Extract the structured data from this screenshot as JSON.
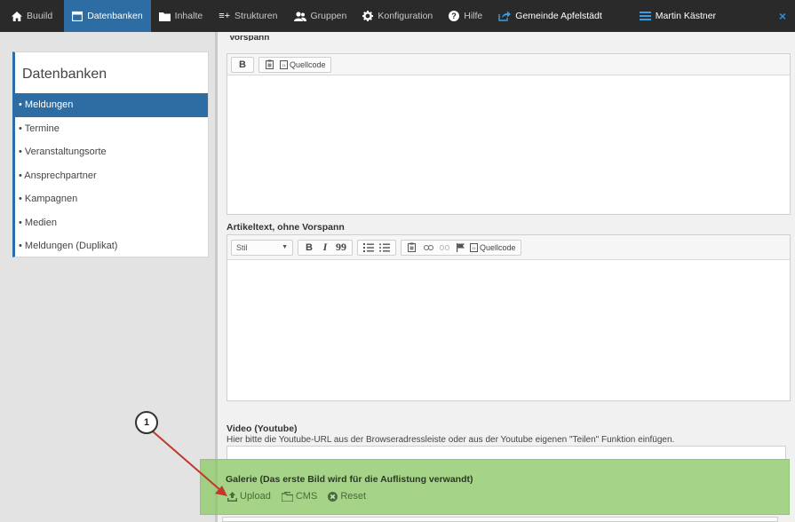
{
  "topbar": {
    "items": [
      {
        "label": "Buuild",
        "icon": "home-icon"
      },
      {
        "label": "Datenbanken",
        "icon": "calendar-icon"
      },
      {
        "label": "Inhalte",
        "icon": "folder-icon"
      },
      {
        "label": "Strukturen",
        "icon": "structure-icon"
      },
      {
        "label": "Gruppen",
        "icon": "users-icon"
      },
      {
        "label": "Konfiguration",
        "icon": "gear-icon"
      },
      {
        "label": "Hilfe",
        "icon": "help-icon"
      },
      {
        "label": "Gemeinde Apfelstädt",
        "icon": "share-icon"
      },
      {
        "label": "Martin Kästner",
        "icon": "menu-icon"
      }
    ],
    "close": "×",
    "accent": "#2e6da4"
  },
  "sidebar": {
    "title": "Datenbanken",
    "items": [
      {
        "label": "• Meldungen",
        "active": true
      },
      {
        "label": "• Termine"
      },
      {
        "label": "• Veranstaltungsorte"
      },
      {
        "label": "• Ansprechpartner"
      },
      {
        "label": "• Kampagnen"
      },
      {
        "label": "• Medien"
      },
      {
        "label": "• Meldungen (Duplikat)"
      }
    ]
  },
  "main": {
    "vorspann": {
      "label": "Vorspann",
      "toolbar": {
        "bold": "B",
        "source": "Quellcode"
      }
    },
    "artikeltext": {
      "label": "Artikeltext, ohne Vorspann",
      "toolbar": {
        "style": "Stil",
        "bold": "B",
        "italic": "I",
        "quote": "99",
        "source": "Quellcode"
      }
    },
    "video": {
      "label": "Video (Youtube)",
      "hint": "Hier bitte die Youtube-URL aus der Browseradressleiste oder aus der Youtube eigenen \"Teilen\" Funktion einfügen.",
      "value": ""
    },
    "gallery": {
      "label": "Galerie (Das erste Bild wird für die Auflistung verwandt)",
      "upload": "Upload",
      "cms": "CMS",
      "reset": "Reset",
      "highlight": "#88c860"
    }
  },
  "annotation": {
    "callout": "1",
    "arrow_color": "#c0392b"
  }
}
